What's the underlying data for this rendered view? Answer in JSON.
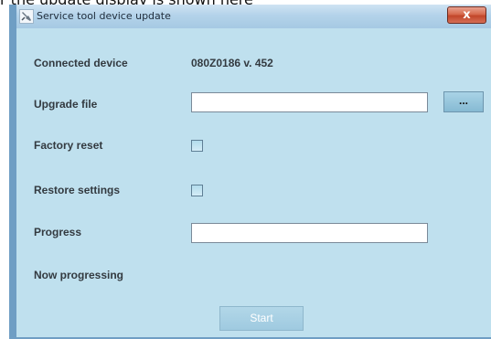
{
  "caption": "r the update display is shown here",
  "window": {
    "title": "Service tool device update",
    "close_label": "x",
    "title_icon": "tool-icon"
  },
  "form": {
    "connected_device_label": "Connected device",
    "connected_device_value": "080Z0186  v. 452",
    "upgrade_file_label": "Upgrade file",
    "upgrade_file_value": "",
    "browse_label": "...",
    "factory_reset_label": "Factory reset",
    "factory_reset_checked": false,
    "restore_settings_label": "Restore settings",
    "restore_settings_checked": false,
    "progress_label": "Progress",
    "progress_value": "",
    "status_label": "Now progressing",
    "start_label": "Start"
  },
  "colors": {
    "window_bg": "#bfe0ee",
    "close_button": "#c2462a",
    "label_text": "#333a40"
  }
}
